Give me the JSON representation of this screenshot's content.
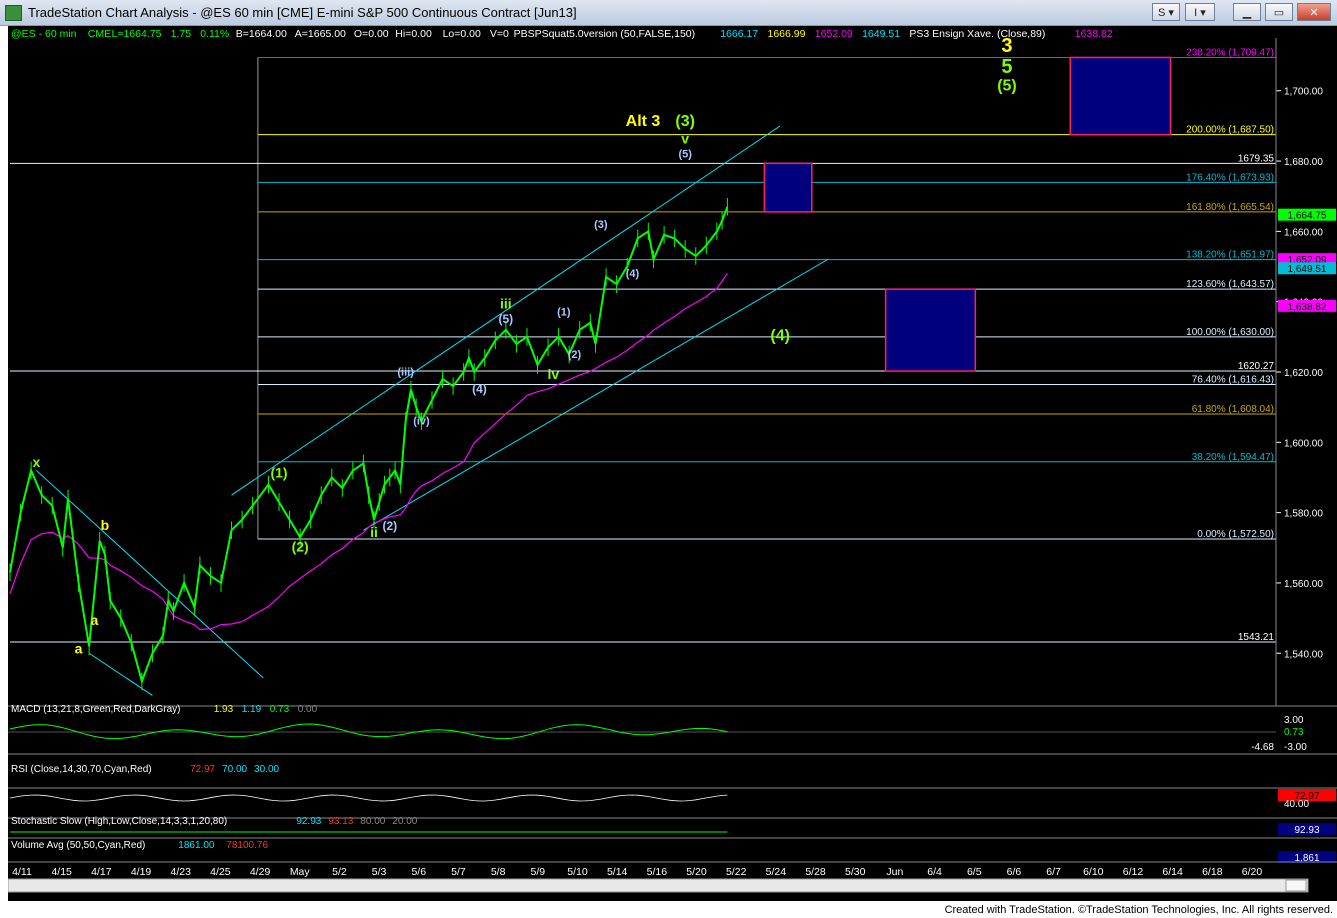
{
  "window": {
    "title": "TradeStation Chart Analysis - @ES 60 min [CME] E-mini S&P 500 Continuous Contract [Jun13]",
    "s_label": "S",
    "i_label": "I"
  },
  "footer": "Created with TradeStation. ©TradeStation Technologies, Inc. All rights reserved.",
  "header": {
    "symbol": "@ES - 60 min",
    "exchange": "CME",
    "last": "L=1664.75",
    "change": "1.75",
    "pct": "0.11%",
    "bid": "B=1664.00",
    "ask": "A=1665.00",
    "o": "O=0.00",
    "hi": "Hi=0.00",
    "lo": "Lo=0.00",
    "v": "V=0",
    "study1": "PBSPSquat5.0version (50,FALSE,150)",
    "study1_vals": [
      "1666.17",
      "1666.99",
      "1652.09",
      "1649.51"
    ],
    "study2": "PS3 Ensign Xave. (Close,89)",
    "study2_val": "1638.82"
  },
  "chart_data": {
    "type": "line",
    "title": "@ES 60 min E-mini S&P 500 Continuous Contract [Jun13]",
    "ylim": [
      1525,
      1715
    ],
    "y_ticks": [
      "1,540.00",
      "1,560.00",
      "1,580.00",
      "1,600.00",
      "1,620.00",
      "1,640.00",
      "1,660.00",
      "1,680.00",
      "1,700.00"
    ],
    "x_ticks": [
      "4/11",
      "4/15",
      "4/17",
      "4/19",
      "4/23",
      "4/25",
      "4/29",
      "May",
      "5/2",
      "5/3",
      "5/6",
      "5/7",
      "5/8",
      "5/9",
      "5/10",
      "5/14",
      "5/16",
      "5/20",
      "5/22",
      "5/24",
      "5/28",
      "5/30",
      "Jun",
      "6/4",
      "6/5",
      "6/6",
      "6/7",
      "6/10",
      "6/12",
      "6/14",
      "6/18",
      "6/20"
    ],
    "price_path": [
      [
        0,
        1563
      ],
      [
        2,
        1580
      ],
      [
        4,
        1592
      ],
      [
        6,
        1585
      ],
      [
        8,
        1582
      ],
      [
        10,
        1570
      ],
      [
        11,
        1584
      ],
      [
        13,
        1560
      ],
      [
        15,
        1542
      ],
      [
        17,
        1572
      ],
      [
        18,
        1568
      ],
      [
        19,
        1555
      ],
      [
        21,
        1550
      ],
      [
        23,
        1543
      ],
      [
        25,
        1532
      ],
      [
        27,
        1540
      ],
      [
        29,
        1545
      ],
      [
        30,
        1555
      ],
      [
        31,
        1552
      ],
      [
        33,
        1560
      ],
      [
        35,
        1553
      ],
      [
        36,
        1565
      ],
      [
        38,
        1562
      ],
      [
        40,
        1560
      ],
      [
        42,
        1575
      ],
      [
        44,
        1578
      ],
      [
        46,
        1582
      ],
      [
        49,
        1588
      ],
      [
        51,
        1583
      ],
      [
        53,
        1578
      ],
      [
        55,
        1573
      ],
      [
        57,
        1578
      ],
      [
        59,
        1585
      ],
      [
        61,
        1590
      ],
      [
        63,
        1587
      ],
      [
        65,
        1592
      ],
      [
        67,
        1594
      ],
      [
        68,
        1585
      ],
      [
        69,
        1578
      ],
      [
        70,
        1583
      ],
      [
        71,
        1588
      ],
      [
        72,
        1590
      ],
      [
        73,
        1592
      ],
      [
        74,
        1588
      ],
      [
        75,
        1606
      ],
      [
        76,
        1615
      ],
      [
        77,
        1610
      ],
      [
        78,
        1606
      ],
      [
        80,
        1612
      ],
      [
        82,
        1618
      ],
      [
        84,
        1616
      ],
      [
        86,
        1620
      ],
      [
        87,
        1624
      ],
      [
        88,
        1620
      ],
      [
        90,
        1624
      ],
      [
        92,
        1629
      ],
      [
        94,
        1632
      ],
      [
        96,
        1628
      ],
      [
        98,
        1630
      ],
      [
        100,
        1622
      ],
      [
        102,
        1627
      ],
      [
        104,
        1630
      ],
      [
        106,
        1625
      ],
      [
        108,
        1632
      ],
      [
        110,
        1634
      ],
      [
        111,
        1628
      ],
      [
        113,
        1647
      ],
      [
        115,
        1645
      ],
      [
        117,
        1650
      ],
      [
        119,
        1658
      ],
      [
        121,
        1660
      ],
      [
        122,
        1652
      ],
      [
        124,
        1659
      ],
      [
        126,
        1658
      ],
      [
        128,
        1655
      ],
      [
        130,
        1653
      ],
      [
        132,
        1656
      ],
      [
        134,
        1660
      ],
      [
        135,
        1663
      ],
      [
        136,
        1667
      ]
    ],
    "bar_end_index": 136,
    "x_max_index": 240,
    "fib_levels": [
      {
        "label": "238.20% (1,709.47)",
        "value": 1709.47,
        "color": "#ff00ff"
      },
      {
        "label": "200.00% (1,687.50)",
        "value": 1687.5,
        "color": "#ffff00"
      },
      {
        "label": "176.40% (1,673.93)",
        "value": 1673.93,
        "color": "#00bcd4"
      },
      {
        "label": "161.80% (1,665.54)",
        "value": 1665.54,
        "color": "#c8a800"
      },
      {
        "label": "138.20% (1,651.97)",
        "value": 1651.97,
        "color": "#00bcd4"
      },
      {
        "label": "123.60% (1,643.57)",
        "value": 1643.57,
        "color": "#d8f0ff"
      },
      {
        "label": "100.00% (1,630.00)",
        "value": 1630.0,
        "color": "#d8f0ff"
      },
      {
        "label": "76.40% (1,616.43)",
        "value": 1616.43,
        "color": "#d8f0ff"
      },
      {
        "label": "61.80% (1,608.04)",
        "value": 1608.04,
        "color": "#c8a800"
      },
      {
        "label": "38.20% (1,594.47)",
        "value": 1594.47,
        "color": "#00bcd4"
      },
      {
        "label": "0.00% (1,572.50)",
        "value": 1572.5,
        "color": "#d8f0ff"
      }
    ],
    "hlines": [
      {
        "label": "1679.35",
        "value": 1679.35
      },
      {
        "label": "1620.27",
        "value": 1620.27
      },
      {
        "label": "1543.21",
        "value": 1543.21
      }
    ],
    "boxes": [
      {
        "x0": 201,
        "x1": 220,
        "y0": 1709.47,
        "y1": 1687.5
      },
      {
        "x0": 143,
        "x1": 152,
        "y0": 1679.35,
        "y1": 1665.54
      },
      {
        "x0": 166,
        "x1": 183,
        "y0": 1643.57,
        "y1": 1620.27
      }
    ],
    "price_boxes": [
      {
        "label": "1,664.75",
        "value": 1664.75,
        "bg": "#00ff00",
        "fg": "#000000"
      },
      {
        "label": "1,652.09",
        "value": 1652.09,
        "bg": "#ff00ff",
        "fg": "#000000"
      },
      {
        "label": "1,649.51",
        "value": 1649.51,
        "bg": "#00bcd4",
        "fg": "#000000"
      },
      {
        "label": "1,638.82",
        "value": 1638.82,
        "bg": "#ff00ff",
        "fg": "#000000"
      }
    ],
    "wave_labels": [
      {
        "t": "x",
        "x": 5,
        "y": 1593,
        "c": "#7fff00",
        "s": 14
      },
      {
        "t": "b",
        "x": 18,
        "y": 1575,
        "c": "#ffff00",
        "s": 14
      },
      {
        "t": "a",
        "x": 16,
        "y": 1548,
        "c": "#ffff00",
        "s": 14
      },
      {
        "t": "a",
        "x": 13,
        "y": 1540,
        "c": "#ffff00",
        "s": 14
      },
      {
        "t": "(1)",
        "x": 51,
        "y": 1590,
        "c": "#7fff00",
        "s": 14
      },
      {
        "t": "(2)",
        "x": 55,
        "y": 1569,
        "c": "#7fff00",
        "s": 14
      },
      {
        "t": "ii",
        "x": 69,
        "y": 1573,
        "c": "#7fff00",
        "s": 14
      },
      {
        "t": "(2)",
        "x": 72,
        "y": 1575,
        "c": "#aac8ff",
        "s": 12
      },
      {
        "t": "(iii)",
        "x": 75,
        "y": 1619,
        "c": "#aac8ff",
        "s": 11
      },
      {
        "t": "(iv)",
        "x": 78,
        "y": 1605,
        "c": "#aac8ff",
        "s": 11
      },
      {
        "t": "(4)",
        "x": 89,
        "y": 1614,
        "c": "#aac8ff",
        "s": 12
      },
      {
        "t": "(5)",
        "x": 94,
        "y": 1634,
        "c": "#aac8ff",
        "s": 12
      },
      {
        "t": "iii",
        "x": 94,
        "y": 1638,
        "c": "#7fff00",
        "s": 14
      },
      {
        "t": "iv",
        "x": 103,
        "y": 1618,
        "c": "#7fff00",
        "s": 14
      },
      {
        "t": "(1)",
        "x": 105,
        "y": 1636,
        "c": "#aac8ff",
        "s": 11
      },
      {
        "t": "(2)",
        "x": 107,
        "y": 1624,
        "c": "#aac8ff",
        "s": 11
      },
      {
        "t": "(3)",
        "x": 112,
        "y": 1661,
        "c": "#aac8ff",
        "s": 11
      },
      {
        "t": "(4)",
        "x": 118,
        "y": 1647,
        "c": "#aac8ff",
        "s": 11
      },
      {
        "t": "(5)",
        "x": 128,
        "y": 1681,
        "c": "#aac8ff",
        "s": 11
      },
      {
        "t": "v",
        "x": 128,
        "y": 1685,
        "c": "#7fff00",
        "s": 14
      },
      {
        "t": "(3)",
        "x": 128,
        "y": 1690,
        "c": "#7fff00",
        "s": 16
      },
      {
        "t": "Alt 3",
        "x": 120,
        "y": 1690,
        "c": "#ffff00",
        "s": 16
      },
      {
        "t": "(4)",
        "x": 146,
        "y": 1629,
        "c": "#7fff00",
        "s": 16
      },
      {
        "t": "3",
        "x": 189,
        "y": 1711,
        "c": "#ffff00",
        "s": 20
      },
      {
        "t": "5",
        "x": 189,
        "y": 1705,
        "c": "#7fff00",
        "s": 20
      },
      {
        "t": "(5)",
        "x": 189,
        "y": 1700,
        "c": "#7fff00",
        "s": 16
      }
    ]
  },
  "macd": {
    "label": "MACD (13,21,8,Green,Red,DarkGray)",
    "vals": [
      "1.93",
      "1.19",
      "0.73",
      "0.00"
    ],
    "axis": [
      "3.00",
      "0.73",
      "-3.00",
      "-4.68"
    ]
  },
  "rsi": {
    "label": "RSI (Close,14,30,70,Cyan,Red)",
    "vals": [
      "72.97",
      "70.00",
      "30.00"
    ],
    "axis": [
      "72.97",
      "40.00"
    ]
  },
  "stoch": {
    "label": "Stochastic Slow (High,Low,Close,14,3,3,1,20,80)",
    "vals": [
      "92.93",
      "93.13",
      "80.00",
      "20.00"
    ],
    "axis": [
      "92.93"
    ]
  },
  "volume": {
    "label": "Volume Avg (50,50,Cyan,Red)",
    "vals": [
      "1861.00",
      "78100.76"
    ],
    "axis": [
      "1,861"
    ]
  }
}
